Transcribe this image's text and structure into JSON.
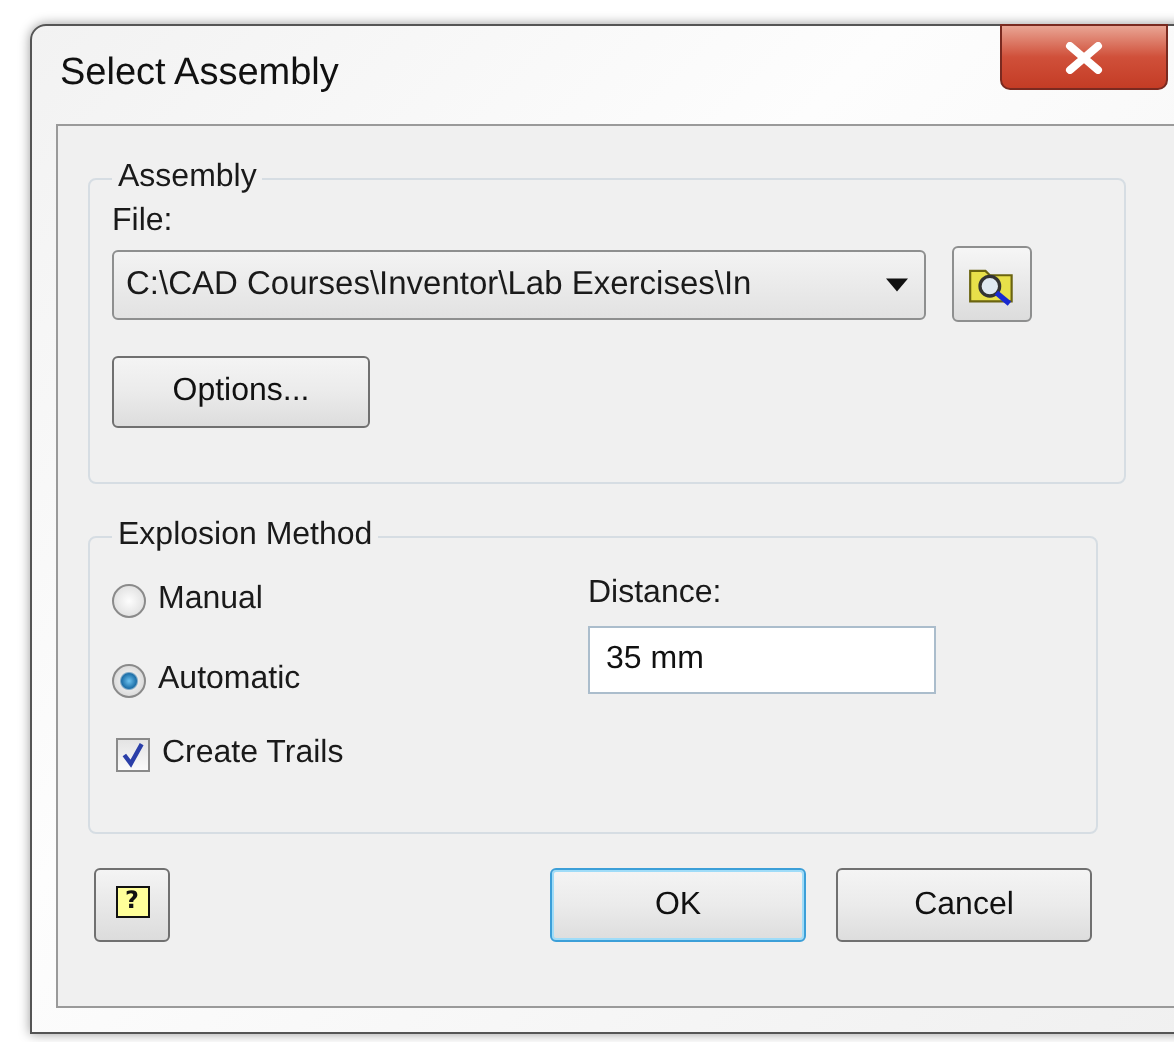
{
  "window": {
    "title": "Select Assembly"
  },
  "assembly": {
    "title": "Assembly",
    "file_label": "File:",
    "file_value": "C:\\CAD Courses\\Inventor\\Lab Exercises\\In",
    "options_button": "Options..."
  },
  "explosion": {
    "title": "Explosion Method",
    "methods": [
      {
        "label": "Manual",
        "selected": false
      },
      {
        "label": "Automatic",
        "selected": true
      }
    ],
    "distance_label": "Distance:",
    "distance_value": "35 mm",
    "create_trails": {
      "label": "Create Trails",
      "checked": true
    }
  },
  "help_button": "?",
  "buttons": [
    {
      "label": "OK",
      "default": true
    },
    {
      "label": "Cancel",
      "default": false
    }
  ]
}
